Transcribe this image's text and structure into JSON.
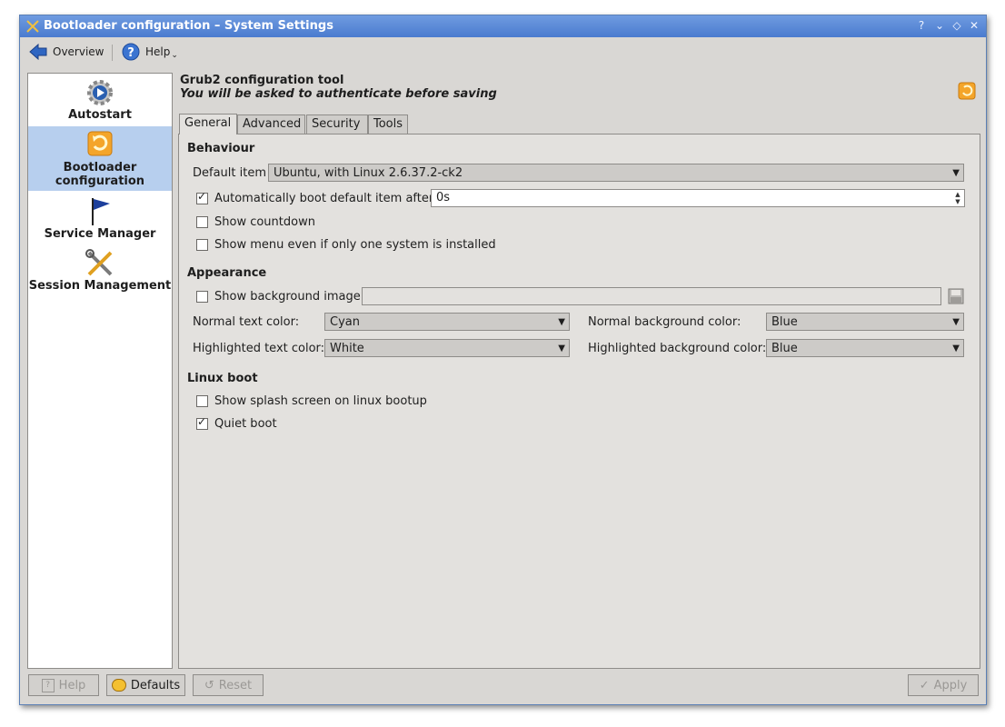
{
  "window": {
    "title": "Bootloader configuration – System Settings",
    "controls": [
      "?",
      "⌄",
      "◇",
      "✕"
    ]
  },
  "toolbar": {
    "overview_label": "Overview",
    "help_label": "Help"
  },
  "sidebar": {
    "items": [
      {
        "label": "Autostart"
      },
      {
        "label": "Bootloader configuration"
      },
      {
        "label": "Service Manager"
      },
      {
        "label": "Session Management"
      }
    ]
  },
  "header": {
    "title": "Grub2 configuration tool",
    "subtitle": "You will be asked to authenticate before saving"
  },
  "tabs": [
    "General",
    "Advanced",
    "Security",
    "Tools"
  ],
  "behaviour": {
    "heading": "Behaviour",
    "default_item_label": "Default item",
    "default_item_value": "Ubuntu, with Linux 2.6.37.2-ck2",
    "autoboot_label": "Automatically boot default item after",
    "autoboot_checked": true,
    "autoboot_value": "0s",
    "countdown_label": "Show countdown",
    "countdown_checked": false,
    "menu_label": "Show menu even if only one system is installed",
    "menu_checked": false
  },
  "appearance": {
    "heading": "Appearance",
    "bg_image_label": "Show background image",
    "bg_image_checked": false,
    "bg_image_value": "",
    "normal_text_label": "Normal text color:",
    "normal_text_value": "Cyan",
    "normal_bg_label": "Normal background color:",
    "normal_bg_value": "Blue",
    "hl_text_label": "Highlighted text color:",
    "hl_text_value": "White",
    "hl_bg_label": "Highlighted background color:",
    "hl_bg_value": "Blue"
  },
  "linux_boot": {
    "heading": "Linux boot",
    "splash_label": "Show splash screen on linux bootup",
    "splash_checked": false,
    "quiet_label": "Quiet boot",
    "quiet_checked": true
  },
  "buttons": {
    "help": "Help",
    "defaults": "Defaults",
    "reset": "Reset",
    "apply": "Apply"
  },
  "colors": {
    "titlebar": "#4a7bcf",
    "selection": "#b7cfee",
    "window_bg": "#d9d7d4"
  }
}
